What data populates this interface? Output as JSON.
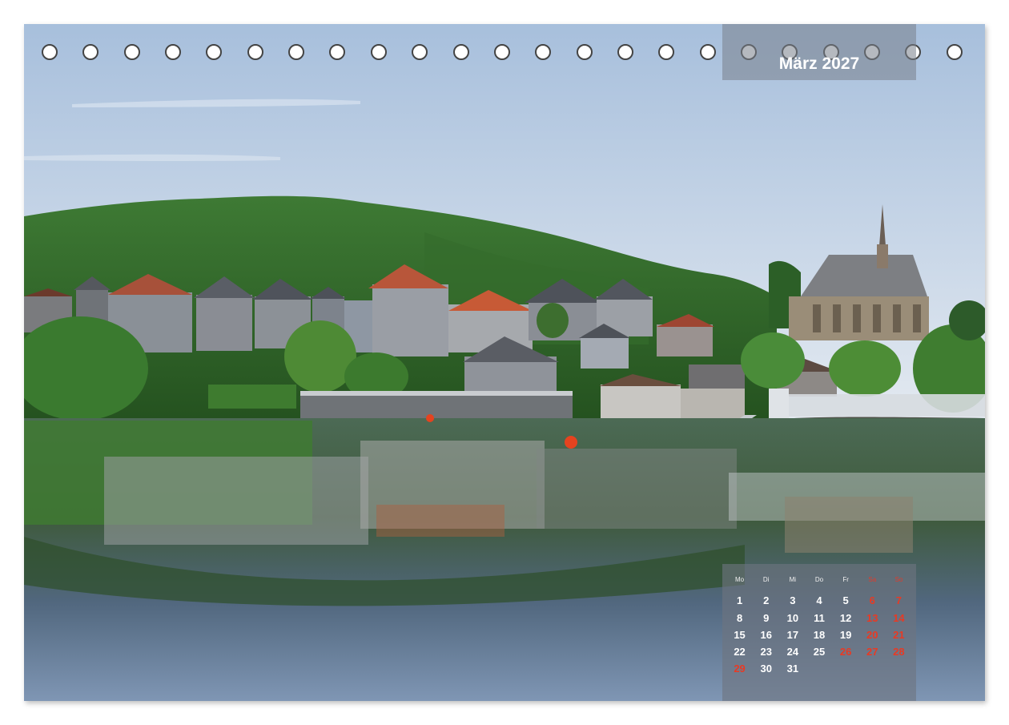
{
  "calendar": {
    "month_title": "März 2027",
    "weekdays": [
      {
        "label": "Mo",
        "weekend": false
      },
      {
        "label": "Di",
        "weekend": false
      },
      {
        "label": "Mi",
        "weekend": false
      },
      {
        "label": "Do",
        "weekend": false
      },
      {
        "label": "Fr",
        "weekend": false
      },
      {
        "label": "Sa",
        "weekend": true
      },
      {
        "label": "So",
        "weekend": true
      }
    ],
    "first_weekday_index": 0,
    "days": [
      "1",
      "2",
      "3",
      "4",
      "5",
      "6",
      "7",
      "8",
      "9",
      "10",
      "11",
      "12",
      "13",
      "14",
      "15",
      "16",
      "17",
      "18",
      "19",
      "20",
      "21",
      "22",
      "23",
      "24",
      "25",
      "26",
      "27",
      "28",
      "29",
      "30",
      "31"
    ],
    "red_days": [
      "6",
      "7",
      "13",
      "14",
      "20",
      "21",
      "26",
      "27",
      "28",
      "29"
    ],
    "ring_count": 23
  },
  "colors": {
    "weekend_red": "#e83a24",
    "sky_top": "#a9c1de",
    "sky_bottom": "#dfe7f0",
    "forest": "#2f6a2c",
    "water": "#3f5670"
  }
}
